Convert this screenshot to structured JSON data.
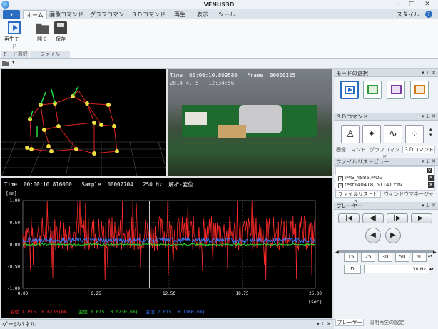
{
  "window": {
    "title": "VENUS3D",
    "style_label": "スタイル"
  },
  "tabs": [
    {
      "label": "ホーム"
    },
    {
      "label": "画像コマンド"
    },
    {
      "label": "グラフコマンド"
    },
    {
      "label": "３Ｄコマンド"
    },
    {
      "label": "再生"
    },
    {
      "label": "表示"
    },
    {
      "label": "ツール"
    }
  ],
  "ribbon": {
    "play_mode": "再生モード",
    "open": "開く",
    "save": "保存",
    "group_mode": "モード選択",
    "group_file": "ファイル"
  },
  "video": {
    "time_label": "Time",
    "time": "00:00:10.809580",
    "frame_label": "Frame",
    "frame": "00000325",
    "overlay": "2014 4. 5   12:34:56"
  },
  "graph": {
    "time_label": "Time",
    "time": "00:00:10.816000",
    "sample_label": "Sample",
    "sample": "00002704",
    "rate": "250 Hz",
    "mode": "解析-変位",
    "yunit": "[mm]",
    "xunit": "[sec]",
    "legend": [
      {
        "label": "変位 X P15",
        "value": "0.6130[mm]",
        "color": "#ff2a2a"
      },
      {
        "label": "変位 Y P15",
        "value": "0.0230[mm]",
        "color": "#2ee02e"
      },
      {
        "label": "変位 Z P15",
        "value": "0.1160[mm]",
        "color": "#3a7bff"
      }
    ]
  },
  "chart_data": {
    "type": "line",
    "xlabel": "[sec]",
    "ylabel": "[mm]",
    "xlim": [
      0,
      25
    ],
    "ylim": [
      -1,
      1
    ],
    "xticks": [
      "0.00",
      "6.25",
      "12.50",
      "18.75",
      "25.00"
    ],
    "yticks": [
      "1.00",
      "0.50",
      "0.00",
      "-0.50",
      "-1.00"
    ],
    "cursor_x": 10.816,
    "series": [
      {
        "name": "変位 X P15",
        "color": "#ff2a2a",
        "amplitude": 0.9,
        "baseline": 0.25
      },
      {
        "name": "変位 Y P15",
        "color": "#2ee02e",
        "amplitude": 0.04,
        "baseline": 0.0
      },
      {
        "name": "変位 Z P15",
        "color": "#3a7bff",
        "amplitude": 0.12,
        "baseline": 0.1
      }
    ]
  },
  "right": {
    "mode_header": "モードの選択",
    "cmd3d_header": "３Ｄコマンド",
    "cmd_tabs": [
      "画像コマンド",
      "グラフコマンド",
      "３Ｄコマンド"
    ],
    "filelist_header": "ファイルリストビュー",
    "files": [
      "IMG_4885.MOV",
      "test140418151141.csv"
    ],
    "file_tabs": [
      "ファイルリストビュー",
      "ウィンドウマネージャー"
    ],
    "player_header": "プレーヤー",
    "fps": [
      "15",
      "25",
      "30",
      "50",
      "60"
    ],
    "fps_value": "30 Hz",
    "d_label": "D",
    "player_tabs": [
      "プレーヤー",
      "周期再生の設定"
    ]
  },
  "gauge": {
    "label": "ゲージパネル"
  }
}
